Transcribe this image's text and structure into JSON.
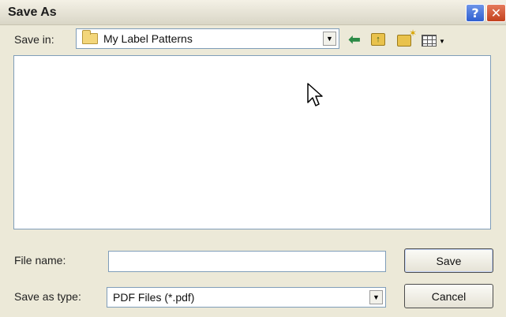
{
  "window": {
    "title": "Save As",
    "help_label": "?",
    "close_label": "✕"
  },
  "save_in": {
    "label": "Save in:",
    "value": "My Label Patterns",
    "icon": "folder-icon"
  },
  "toolbar": {
    "icons": [
      "back-arrow-icon",
      "up-folder-icon",
      "new-folder-icon",
      "views-menu-icon"
    ]
  },
  "file_list": {
    "items": []
  },
  "file_name": {
    "label": "File name:",
    "value": "",
    "placeholder": ""
  },
  "save_as_type": {
    "label": "Save as type:",
    "value": "PDF Files (*.pdf)"
  },
  "buttons": {
    "save": "Save",
    "cancel": "Cancel"
  }
}
